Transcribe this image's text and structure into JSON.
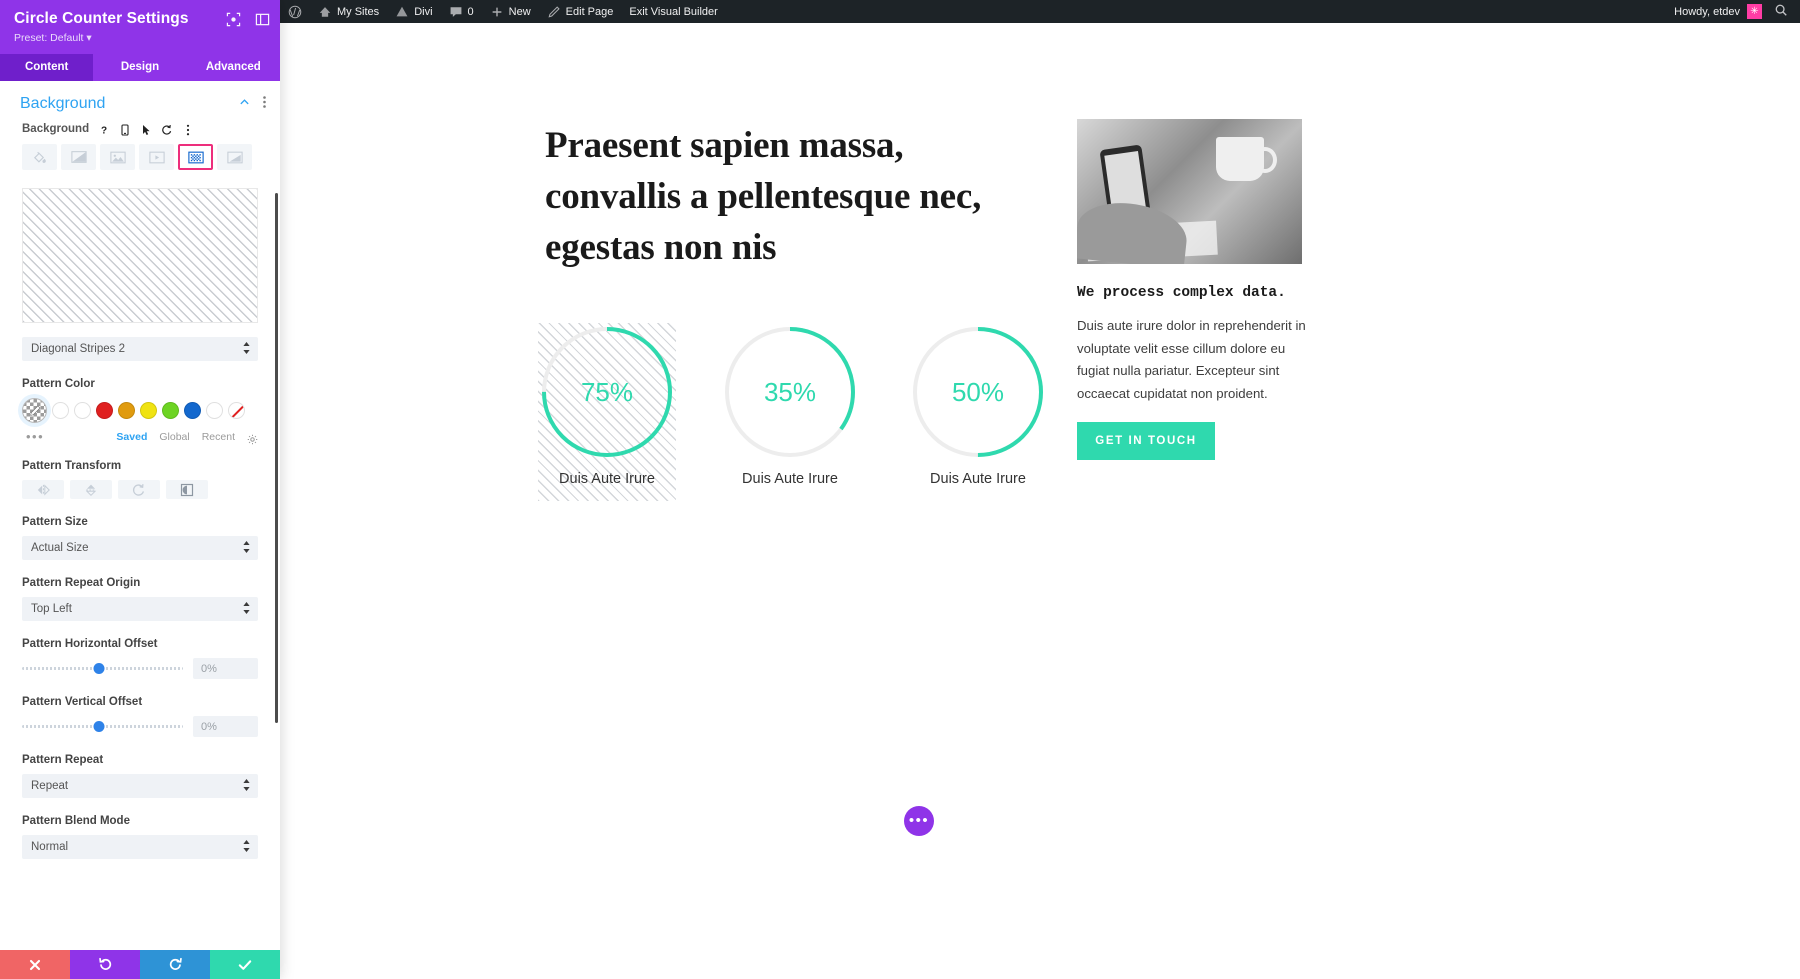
{
  "panel": {
    "title": "Circle Counter Settings",
    "preset": "Preset: Default",
    "preset_caret": "▾",
    "head_icons": [
      {
        "name": "focus-target-icon"
      },
      {
        "name": "layout-toggle-icon"
      }
    ],
    "tabs": [
      {
        "label": "Content",
        "active": true
      },
      {
        "label": "Design",
        "active": false
      },
      {
        "label": "Advanced",
        "active": false
      }
    ],
    "section": {
      "title": "Background",
      "collapse_icon": "chevron-up-icon",
      "more_icon": "vertical-dots-icon"
    },
    "background_field": {
      "label": "Background",
      "icons": [
        "help-icon",
        "responsive-icon",
        "hover-icon",
        "reset-icon",
        "vertical-dots-icon"
      ],
      "types": [
        {
          "name": "color-fill",
          "selected": false
        },
        {
          "name": "gradient",
          "selected": false
        },
        {
          "name": "image",
          "selected": false
        },
        {
          "name": "video",
          "selected": false
        },
        {
          "name": "pattern",
          "selected": true
        },
        {
          "name": "mask",
          "selected": false
        }
      ],
      "selected_outline_color": "#ED2E7C"
    },
    "pattern_select": {
      "label": "",
      "value": "Diagonal Stripes 2"
    },
    "pattern_color": {
      "label": "Pattern Color",
      "current_name": "custom-color-picker",
      "swatches": [
        {
          "name": "white-1",
          "color": "#ffffff"
        },
        {
          "name": "white-2",
          "color": "#ffffff"
        },
        {
          "name": "red",
          "color": "#E02020"
        },
        {
          "name": "orange",
          "color": "#E09B0F"
        },
        {
          "name": "yellow",
          "color": "#F0E312"
        },
        {
          "name": "green",
          "color": "#6DD423"
        },
        {
          "name": "blue",
          "color": "#1368CE"
        },
        {
          "name": "white-3",
          "color": "#ffffff"
        },
        {
          "name": "none",
          "color": "#ffffff"
        }
      ],
      "meta": [
        {
          "label": "Saved",
          "active": true
        },
        {
          "label": "Global",
          "active": false
        },
        {
          "label": "Recent",
          "active": false
        }
      ],
      "gear_icon": "gear-icon",
      "dots_icon": "horizontal-dots-icon"
    },
    "pattern_transform": {
      "label": "Pattern Transform",
      "buttons": [
        "flip-horizontal-icon",
        "flip-vertical-icon",
        "rotate-icon",
        "invert-icon"
      ]
    },
    "pattern_size": {
      "label": "Pattern Size",
      "value": "Actual Size"
    },
    "pattern_repeat_origin": {
      "label": "Pattern Repeat Origin",
      "value": "Top Left"
    },
    "pattern_h_offset": {
      "label": "Pattern Horizontal Offset",
      "value": "0%",
      "knob_pct": 48
    },
    "pattern_v_offset": {
      "label": "Pattern Vertical Offset",
      "value": "0%",
      "knob_pct": 48
    },
    "pattern_repeat": {
      "label": "Pattern Repeat",
      "value": "Repeat"
    },
    "pattern_blend": {
      "label": "Pattern Blend Mode",
      "value": "Normal"
    },
    "actions": [
      {
        "name": "cancel",
        "icon": "✕",
        "color": "#F06565"
      },
      {
        "name": "undo",
        "icon": "↺",
        "color": "#8F34E8"
      },
      {
        "name": "redo",
        "icon": "↻",
        "color": "#2E93D6"
      },
      {
        "name": "save",
        "icon": "✓",
        "color": "#2FD9AE"
      }
    ],
    "caret": "⇕"
  },
  "adminbar": {
    "items": [
      {
        "name": "wordpress-logo",
        "label": "",
        "icon": "wordpress-icon"
      },
      {
        "name": "my-sites",
        "label": "My Sites",
        "icon": "sites-icon"
      },
      {
        "name": "divi",
        "label": "Divi",
        "icon": "divi-icon"
      },
      {
        "name": "comments",
        "label": "0",
        "icon": "comment-icon"
      },
      {
        "name": "new",
        "label": "New",
        "icon": "plus-icon"
      },
      {
        "name": "edit-page",
        "label": "Edit Page",
        "icon": "pencil-icon"
      },
      {
        "name": "exit-visual-builder",
        "label": "Exit Visual Builder",
        "icon": ""
      }
    ],
    "howdy": "Howdy, etdev",
    "avatar_glyph": "✳",
    "search_icon": "search-icon"
  },
  "content": {
    "headline": "Praesent sapien massa, convallis a pellentesque nec, egestas non nis",
    "counters": [
      {
        "percent": 75,
        "label_value": "75%",
        "label": "Duis Aute Irure",
        "patterned": true
      },
      {
        "percent": 35,
        "label_value": "35%",
        "label": "Duis Aute Irure",
        "patterned": false
      },
      {
        "percent": 50,
        "label_value": "50%",
        "label": "Duis Aute Irure",
        "patterned": false
      }
    ],
    "accent_color": "#2FD9AE",
    "track_color": "#EDEDED",
    "side_heading": "We process complex data.",
    "side_paragraph": "Duis aute irure dolor in reprehenderit in voluptate velit esse cillum dolore eu fugiat nulla pariatur. Excepteur sint occaecat cupidatat non proident.",
    "cta_label": "GET IN TOUCH",
    "fab_icon": "•••"
  }
}
